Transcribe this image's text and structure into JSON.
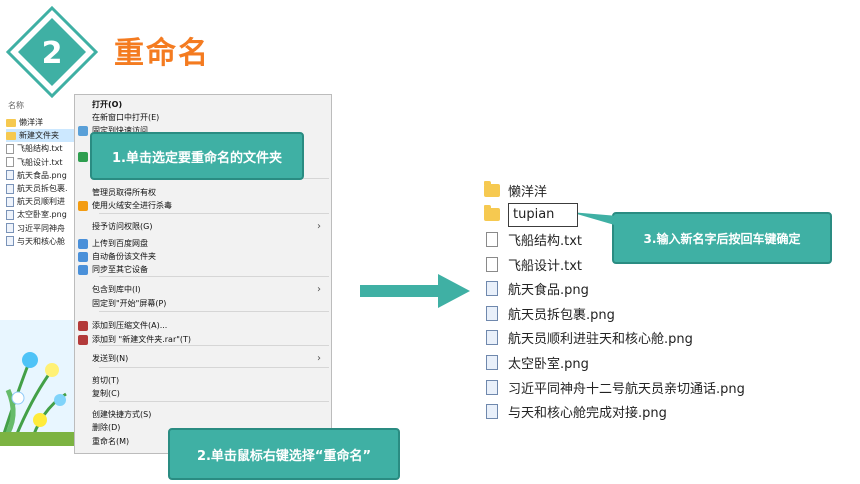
{
  "header": {
    "step_number": "2",
    "title": "重命名"
  },
  "left_explorer": {
    "column_header": "名称",
    "items": [
      {
        "name": "懒洋洋",
        "type": "folder"
      },
      {
        "name": "新建文件夹",
        "type": "folder",
        "selected": true
      },
      {
        "name": "飞船结构.txt",
        "type": "txt"
      },
      {
        "name": "飞船设计.txt",
        "type": "txt"
      },
      {
        "name": "航天食品.png",
        "type": "png"
      },
      {
        "name": "航天员拆包裹.",
        "type": "png"
      },
      {
        "name": "航天员顺利进",
        "type": "png"
      },
      {
        "name": "太空卧室.png",
        "type": "png"
      },
      {
        "name": "习近平同神舟",
        "type": "png"
      },
      {
        "name": "与天和核心舱",
        "type": "png"
      }
    ]
  },
  "context_menu": {
    "items": [
      {
        "label": "打开(O)",
        "bold": true
      },
      {
        "label": "在新窗口中打开(E)"
      },
      {
        "label": "固定到快速访问"
      },
      {
        "label": ""
      },
      {
        "label": ""
      },
      {
        "label": "管理员取得所有权"
      },
      {
        "label": "使用火绒安全进行杀毒"
      },
      {
        "label": "授予访问权限(G)",
        "submenu": true
      },
      {
        "label": "上传到百度网盘"
      },
      {
        "label": "自动备份该文件夹"
      },
      {
        "label": "同步至其它设备"
      },
      {
        "label": "包含到库中(I)",
        "submenu": true
      },
      {
        "label": "固定到\"开始\"屏幕(P)"
      },
      {
        "label": "添加到压缩文件(A)..."
      },
      {
        "label": "添加到 \"新建文件夹.rar\"(T)"
      },
      {
        "label": "发送到(N)",
        "submenu": true
      },
      {
        "label": "剪切(T)"
      },
      {
        "label": "复制(C)"
      },
      {
        "label": "创建快捷方式(S)"
      },
      {
        "label": "删除(D)"
      },
      {
        "label": "重命名(M)"
      }
    ]
  },
  "callouts": {
    "step1": "1.单击选定要重命名的文件夹",
    "step2": "2.单击鼠标右键选择“重命名”",
    "step3": "3.输入新名字后按回车键确定"
  },
  "right_explorer": {
    "items": [
      {
        "name": "懒洋洋",
        "type": "folder"
      },
      {
        "name": "tupian",
        "type": "folder",
        "editing": true
      },
      {
        "name": "飞船结构.txt",
        "type": "txt"
      },
      {
        "name": "飞船设计.txt",
        "type": "txt"
      },
      {
        "name": "航天食品.png",
        "type": "png"
      },
      {
        "name": "航天员拆包裹.png",
        "type": "png"
      },
      {
        "name": "航天员顺利进驻天和核心舱.png",
        "type": "png"
      },
      {
        "name": "太空卧室.png",
        "type": "png"
      },
      {
        "name": "习近平同神舟十二号航天员亲切通话.png",
        "type": "png"
      },
      {
        "name": "与天和核心舱完成对接.png",
        "type": "png"
      }
    ]
  },
  "colors": {
    "accent_teal": "#3fb0a4",
    "title_orange": "#f47b20",
    "folder_yellow": "#f6c950",
    "selection_blue": "#cce8ff"
  }
}
